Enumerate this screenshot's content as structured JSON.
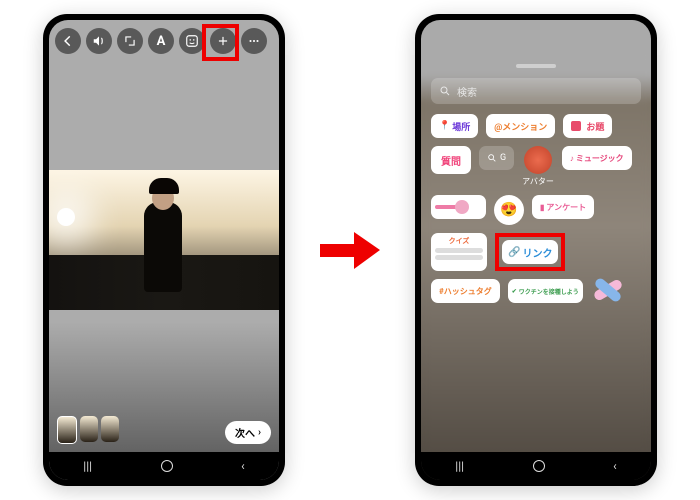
{
  "left": {
    "next_label": "次へ",
    "toolbar_icons": [
      "back",
      "audio",
      "crop",
      "text",
      "sticker",
      "add",
      "more"
    ]
  },
  "right": {
    "search_placeholder": "検索",
    "stickers": {
      "location": "場所",
      "mention": "@メンション",
      "odai": "お題",
      "question": "質問",
      "gif": "G",
      "avatar": "アバター",
      "music": "ミュージック",
      "poll": "アンケート",
      "quiz": "クイズ",
      "link": "リンク",
      "hashtag": "#ハッシュタグ",
      "vaccine": "ワクチンを接種しよう"
    }
  }
}
